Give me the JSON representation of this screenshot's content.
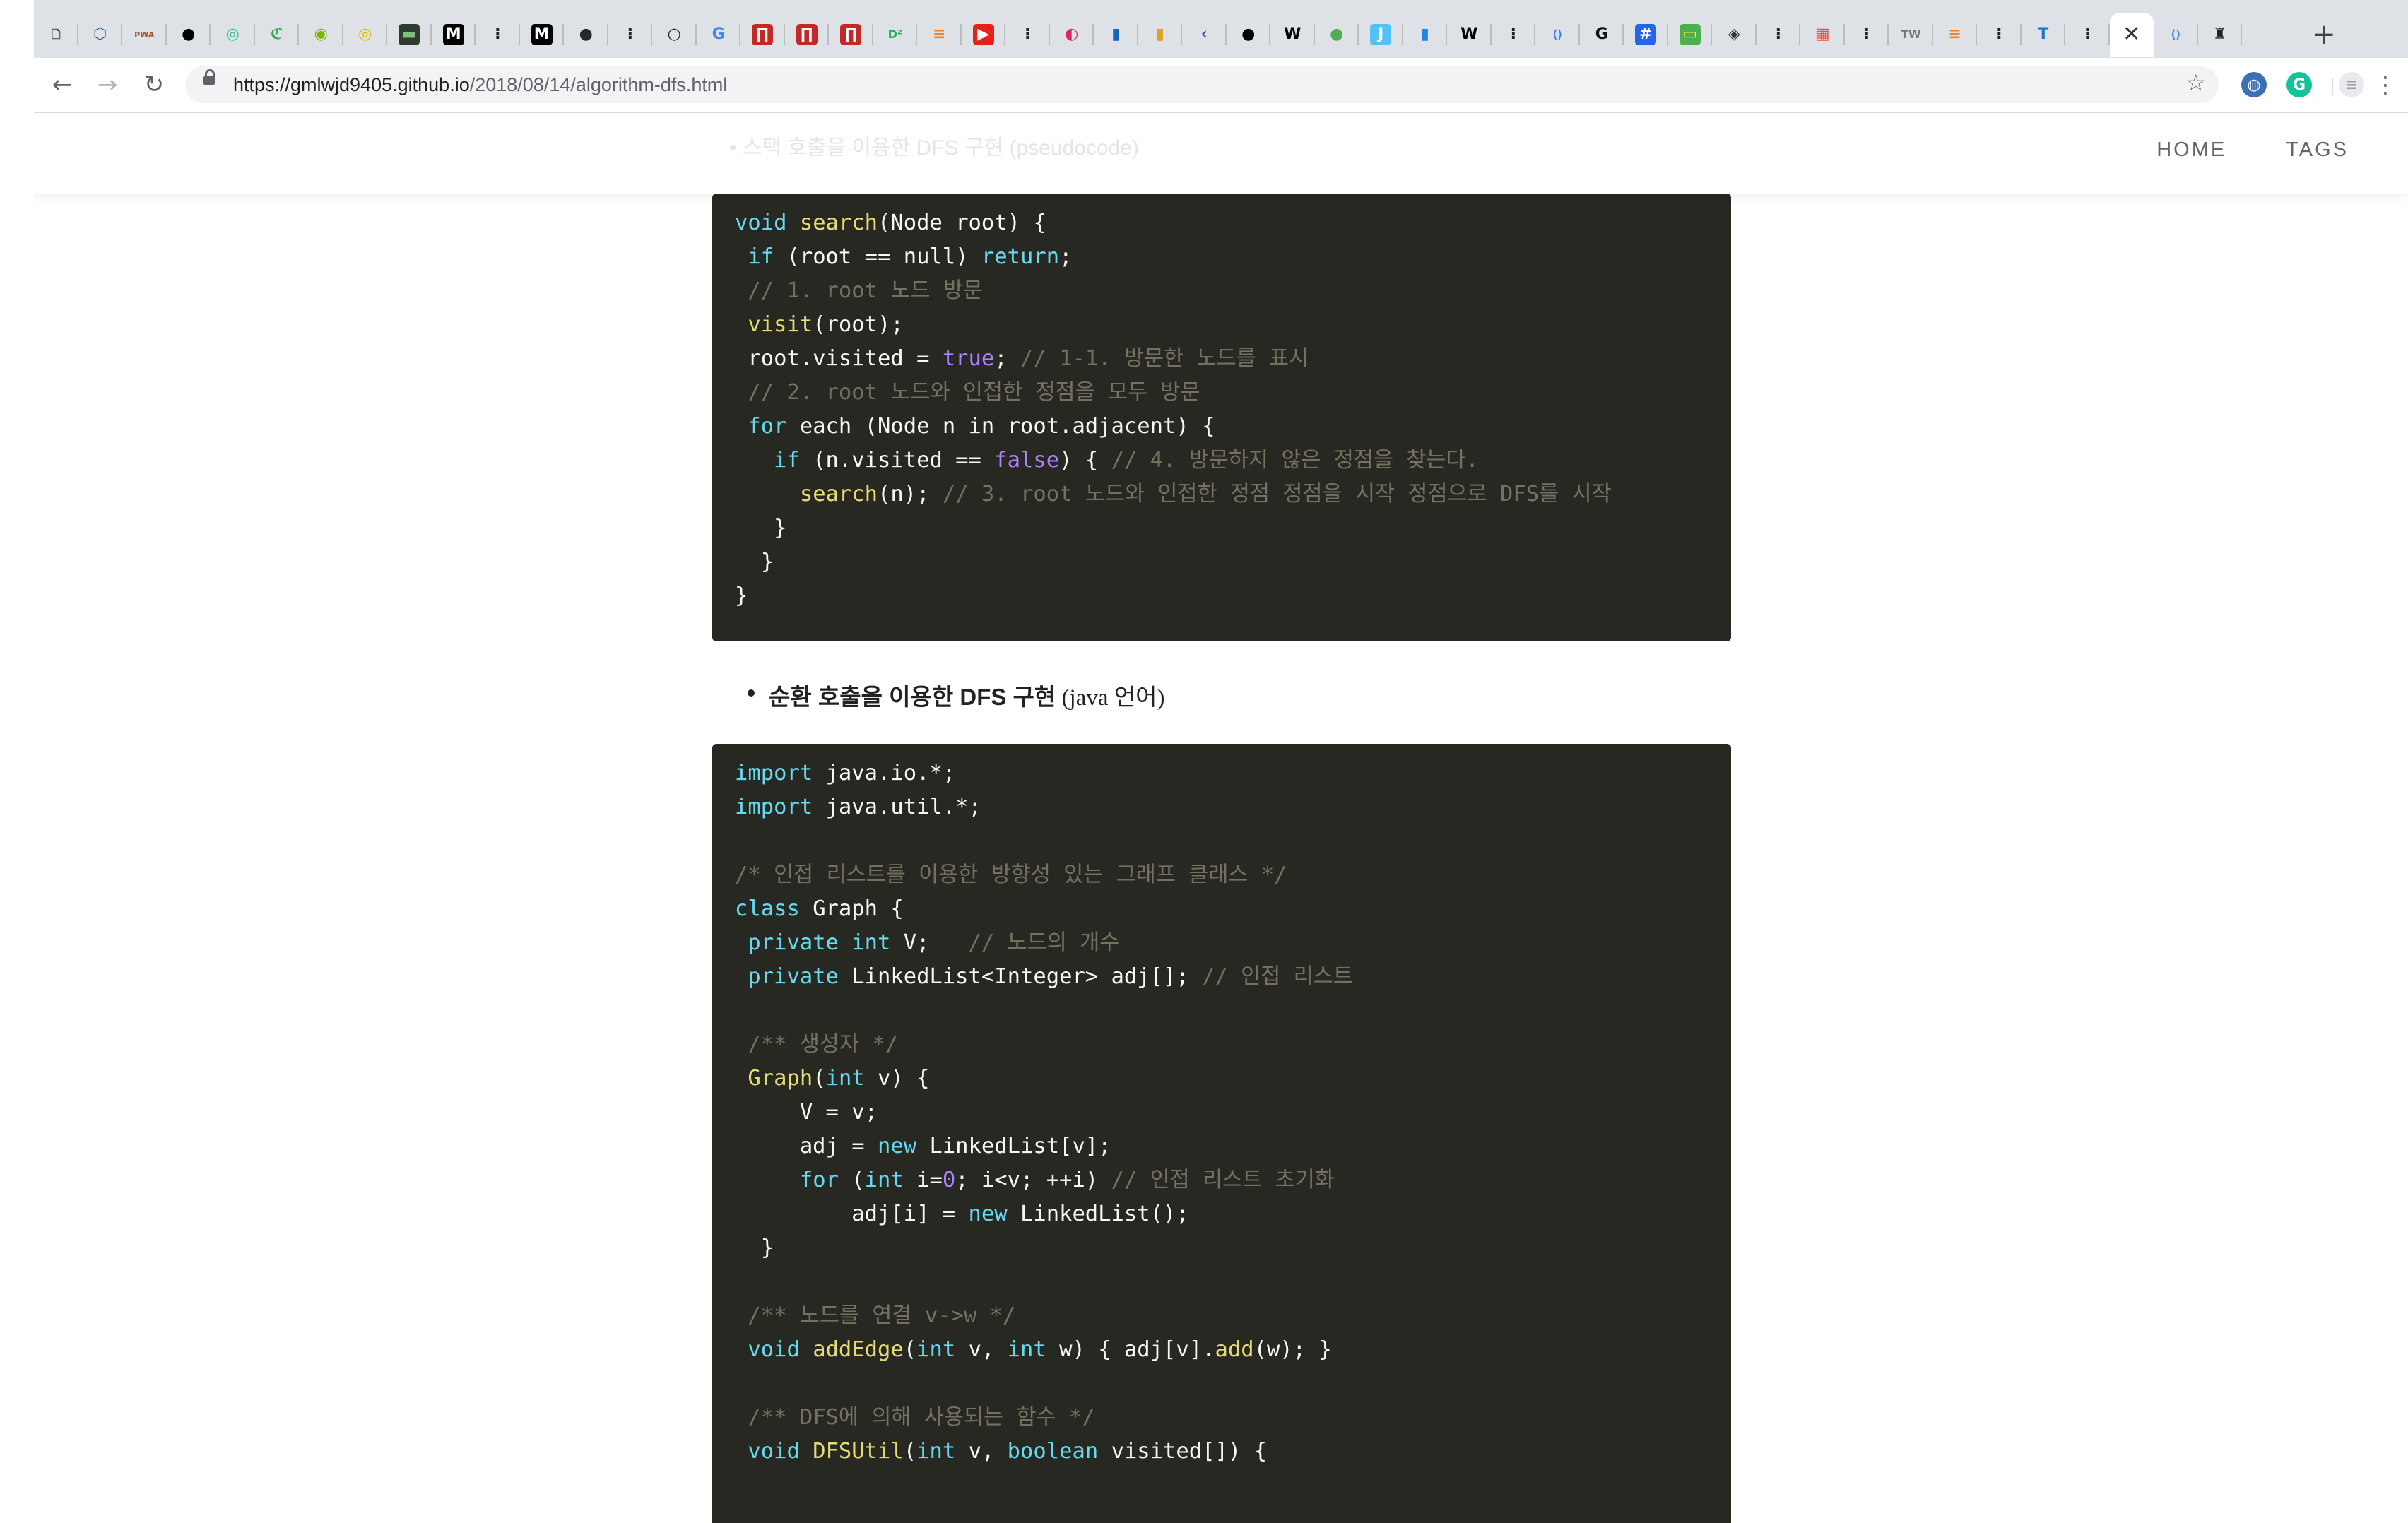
{
  "browser": {
    "tabs": [
      {
        "icon": "page-icon",
        "glyph": "🗋",
        "bg": "",
        "fg": "#444"
      },
      {
        "icon": "hex-icon",
        "glyph": "⬡",
        "bg": "",
        "fg": "#2a5d9b"
      },
      {
        "icon": "pwa-icon",
        "glyph": "PWA",
        "bg": "",
        "fg": "#a0522d"
      },
      {
        "icon": "black-circle-icon",
        "glyph": "●",
        "bg": "",
        "fg": "#000"
      },
      {
        "icon": "green-swirl-icon",
        "glyph": "◎",
        "bg": "",
        "fg": "#35c28c"
      },
      {
        "icon": "c-logo-icon",
        "glyph": "ℭ",
        "bg": "",
        "fg": "#3aa757"
      },
      {
        "icon": "nvidia-icon",
        "glyph": "◉",
        "bg": "",
        "fg": "#76b900"
      },
      {
        "icon": "yellow-circle-icon",
        "glyph": "◎",
        "bg": "",
        "fg": "#e5b800"
      },
      {
        "icon": "terminal-icon",
        "glyph": "▬",
        "bg": "#2f3b2f",
        "fg": "#7ec07e"
      },
      {
        "icon": "medium-icon",
        "glyph": "M",
        "bg": "#000",
        "fg": "#fff"
      },
      {
        "icon": "tree-icon",
        "glyph": "⁝",
        "bg": "",
        "fg": "#222"
      },
      {
        "icon": "medium-icon",
        "glyph": "M",
        "bg": "#000",
        "fg": "#fff"
      },
      {
        "icon": "github-icon",
        "glyph": "●",
        "bg": "",
        "fg": "#24292e"
      },
      {
        "icon": "tree-icon",
        "glyph": "⁝",
        "bg": "",
        "fg": "#222"
      },
      {
        "icon": "ring-icon",
        "glyph": "○",
        "bg": "",
        "fg": "#222"
      },
      {
        "icon": "google-icon",
        "glyph": "G",
        "bg": "",
        "fg": "#4285f4"
      },
      {
        "icon": "red-box-icon",
        "glyph": "∏",
        "bg": "#c62828",
        "fg": "#fff"
      },
      {
        "icon": "red-box-icon",
        "glyph": "∏",
        "bg": "#c62828",
        "fg": "#fff"
      },
      {
        "icon": "red-box-icon",
        "glyph": "∏",
        "bg": "#c62828",
        "fg": "#fff"
      },
      {
        "icon": "d2-icon",
        "glyph": "D²",
        "bg": "",
        "fg": "#2eaa5a"
      },
      {
        "icon": "stackoverflow-icon",
        "glyph": "≡",
        "bg": "",
        "fg": "#f48024"
      },
      {
        "icon": "youtube-icon",
        "glyph": "▶",
        "bg": "#e62117",
        "fg": "#fff"
      },
      {
        "icon": "tree-icon",
        "glyph": "⁝",
        "bg": "",
        "fg": "#222"
      },
      {
        "icon": "pink-circle-icon",
        "glyph": "◐",
        "bg": "",
        "fg": "#e0245e"
      },
      {
        "icon": "bar-chart-icon",
        "glyph": "▮",
        "bg": "",
        "fg": "#1565c0"
      },
      {
        "icon": "bar-chart-icon",
        "glyph": "▮",
        "bg": "",
        "fg": "#e3a21a"
      },
      {
        "icon": "chevron-left-icon",
        "glyph": "‹",
        "bg": "",
        "fg": "#3949ab"
      },
      {
        "icon": "black-circle-icon",
        "glyph": "●",
        "bg": "",
        "fg": "#000"
      },
      {
        "icon": "wikipedia-icon",
        "glyph": "W",
        "bg": "",
        "fg": "#000"
      },
      {
        "icon": "green-circle-icon",
        "glyph": "●",
        "bg": "",
        "fg": "#4caf50"
      },
      {
        "icon": "blue-j-icon",
        "glyph": "J",
        "bg": "#4fc3f7",
        "fg": "#fff"
      },
      {
        "icon": "bar-chart-icon",
        "glyph": "▮",
        "bg": "",
        "fg": "#1e88e5"
      },
      {
        "icon": "wikipedia-icon",
        "glyph": "W",
        "bg": "",
        "fg": "#000"
      },
      {
        "icon": "tree-icon",
        "glyph": "⁝",
        "bg": "",
        "fg": "#222"
      },
      {
        "icon": "code-icon",
        "glyph": "⟨⟩",
        "bg": "",
        "fg": "#3b82f6"
      },
      {
        "icon": "g-logo-icon",
        "glyph": "G",
        "bg": "",
        "fg": "#111"
      },
      {
        "icon": "hash-icon",
        "glyph": "#",
        "bg": "#2563eb",
        "fg": "#fff"
      },
      {
        "icon": "green-box-icon",
        "glyph": "▭",
        "bg": "#4caf50",
        "fg": "#ffeb3b"
      },
      {
        "icon": "diamond-icon",
        "glyph": "◈",
        "bg": "",
        "fg": "#333"
      },
      {
        "icon": "tree-icon",
        "glyph": "⁝",
        "bg": "",
        "fg": "#222"
      },
      {
        "icon": "microsoft-icon",
        "glyph": "▦",
        "bg": "",
        "fg": "#f25022"
      },
      {
        "icon": "tree-icon",
        "glyph": "⁝",
        "bg": "",
        "fg": "#222"
      },
      {
        "icon": "tw-icon",
        "glyph": "TW",
        "bg": "",
        "fg": "#777"
      },
      {
        "icon": "stackoverflow-icon",
        "glyph": "≡",
        "bg": "",
        "fg": "#f48024"
      },
      {
        "icon": "tree-icon",
        "glyph": "⁝",
        "bg": "",
        "fg": "#222"
      },
      {
        "icon": "t-logo-icon",
        "glyph": "T",
        "bg": "",
        "fg": "#1976d2"
      },
      {
        "icon": "tree-icon",
        "glyph": "⁝",
        "bg": "",
        "fg": "#222"
      },
      {
        "icon": "close-icon",
        "glyph": "✕",
        "bg": "",
        "fg": "#333",
        "active": true
      },
      {
        "icon": "code-icon",
        "glyph": "⟨⟩",
        "bg": "",
        "fg": "#3b82f6"
      },
      {
        "icon": "avatar-icon",
        "glyph": "♜",
        "bg": "",
        "fg": "#222"
      }
    ],
    "new_tab_glyph": "+",
    "nav": {
      "back": "←",
      "forward": "→",
      "reload": "↻"
    },
    "url": {
      "host": "https://gmlwjd9405.github.io",
      "path": "/2018/08/14/algorithm-dfs.html"
    },
    "bookmark_glyph": "☆",
    "menu_glyph": "⋮"
  },
  "site": {
    "nav": [
      "HOME",
      "TAGS"
    ],
    "faded_bullet": "• 스택 호출을 이용한 DFS 구현 (pseudocode)"
  },
  "code_blocks": [
    {
      "lines": [
        [
          [
            "k",
            "void"
          ],
          [
            "",
            " "
          ],
          [
            "f",
            "search"
          ],
          [
            "",
            "(Node root) {"
          ]
        ],
        [
          [
            "",
            " "
          ],
          [
            "k",
            "if"
          ],
          [
            "",
            " (root == null) "
          ],
          [
            "k",
            "return"
          ],
          [
            "",
            ";"
          ]
        ],
        [
          [
            "",
            " "
          ],
          [
            "c",
            "// 1. root 노드 방문"
          ]
        ],
        [
          [
            "",
            " "
          ],
          [
            "f",
            "visit"
          ],
          [
            "",
            "(root);"
          ]
        ],
        [
          [
            "",
            " root.visited = "
          ],
          [
            "n",
            "true"
          ],
          [
            "",
            "; "
          ],
          [
            "c",
            "// 1-1. 방문한 노드를 표시"
          ]
        ],
        [
          [
            "",
            " "
          ],
          [
            "c",
            "// 2. root 노드와 인접한 정점을 모두 방문"
          ]
        ],
        [
          [
            "",
            " "
          ],
          [
            "k",
            "for"
          ],
          [
            "",
            " each (Node n in root.adjacent) {"
          ]
        ],
        [
          [
            "",
            "   "
          ],
          [
            "k",
            "if"
          ],
          [
            "",
            " (n.visited == "
          ],
          [
            "n",
            "false"
          ],
          [
            "",
            ") { "
          ],
          [
            "c",
            "// 4. 방문하지 않은 정점을 찾는다."
          ]
        ],
        [
          [
            "",
            "     "
          ],
          [
            "f",
            "search"
          ],
          [
            "",
            "(n); "
          ],
          [
            "c",
            "// 3. root 노드와 인접한 정점 정점을 시작 정점으로 DFS를 시작"
          ]
        ],
        [
          [
            "",
            "   }"
          ]
        ],
        [
          [
            "",
            "  }"
          ]
        ],
        [
          [
            "",
            "}"
          ]
        ]
      ]
    },
    {
      "lines": [
        [
          [
            "k",
            "import"
          ],
          [
            "",
            " java.io.*;"
          ]
        ],
        [
          [
            "k",
            "import"
          ],
          [
            "",
            " java.util.*;"
          ]
        ],
        [
          [
            "",
            ""
          ]
        ],
        [
          [
            "c",
            "/* 인접 리스트를 이용한 방향성 있는 그래프 클래스 */"
          ]
        ],
        [
          [
            "k",
            "class"
          ],
          [
            "",
            " Graph {"
          ]
        ],
        [
          [
            "",
            " "
          ],
          [
            "k",
            "private"
          ],
          [
            "",
            " "
          ],
          [
            "k",
            "int"
          ],
          [
            "",
            " V;   "
          ],
          [
            "c",
            "// 노드의 개수"
          ]
        ],
        [
          [
            "",
            " "
          ],
          [
            "k",
            "private"
          ],
          [
            "",
            " LinkedList<Integer> adj[]; "
          ],
          [
            "c",
            "// 인접 리스트"
          ]
        ],
        [
          [
            "",
            ""
          ]
        ],
        [
          [
            "",
            " "
          ],
          [
            "c",
            "/** 생성자 */"
          ]
        ],
        [
          [
            "",
            " "
          ],
          [
            "f",
            "Graph"
          ],
          [
            "",
            "("
          ],
          [
            "k",
            "int"
          ],
          [
            "",
            " v) {"
          ]
        ],
        [
          [
            "",
            "     V = v;"
          ]
        ],
        [
          [
            "",
            "     adj = "
          ],
          [
            "k",
            "new"
          ],
          [
            "",
            " LinkedList[v];"
          ]
        ],
        [
          [
            "",
            "     "
          ],
          [
            "k",
            "for"
          ],
          [
            "",
            " ("
          ],
          [
            "k",
            "int"
          ],
          [
            "",
            " i="
          ],
          [
            "n",
            "0"
          ],
          [
            "",
            "; i<v; ++i) "
          ],
          [
            "c",
            "// 인접 리스트 초기화"
          ]
        ],
        [
          [
            "",
            "         adj[i] = "
          ],
          [
            "k",
            "new"
          ],
          [
            "",
            " LinkedList();"
          ]
        ],
        [
          [
            "",
            "  }"
          ]
        ],
        [
          [
            "",
            ""
          ]
        ],
        [
          [
            "",
            " "
          ],
          [
            "c",
            "/** 노드를 연결 v->w */"
          ]
        ],
        [
          [
            "",
            " "
          ],
          [
            "k",
            "void"
          ],
          [
            "",
            " "
          ],
          [
            "f",
            "addEdge"
          ],
          [
            "",
            "("
          ],
          [
            "k",
            "int"
          ],
          [
            "",
            " v, "
          ],
          [
            "k",
            "int"
          ],
          [
            "",
            " w) { adj[v]."
          ],
          [
            "f",
            "add"
          ],
          [
            "",
            "(w); }"
          ]
        ],
        [
          [
            "",
            ""
          ]
        ],
        [
          [
            "",
            " "
          ],
          [
            "c",
            "/** DFS에 의해 사용되는 함수 */"
          ]
        ],
        [
          [
            "",
            " "
          ],
          [
            "k",
            "void"
          ],
          [
            "",
            " "
          ],
          [
            "f",
            "DFSUtil"
          ],
          [
            "",
            "("
          ],
          [
            "k",
            "int"
          ],
          [
            "",
            " v, "
          ],
          [
            "k",
            "boolean"
          ],
          [
            "",
            " visited[]) {"
          ]
        ]
      ]
    }
  ],
  "bullet": {
    "bold": "순환 호출을 이용한 DFS 구현",
    "rest": " (java 언어)"
  }
}
